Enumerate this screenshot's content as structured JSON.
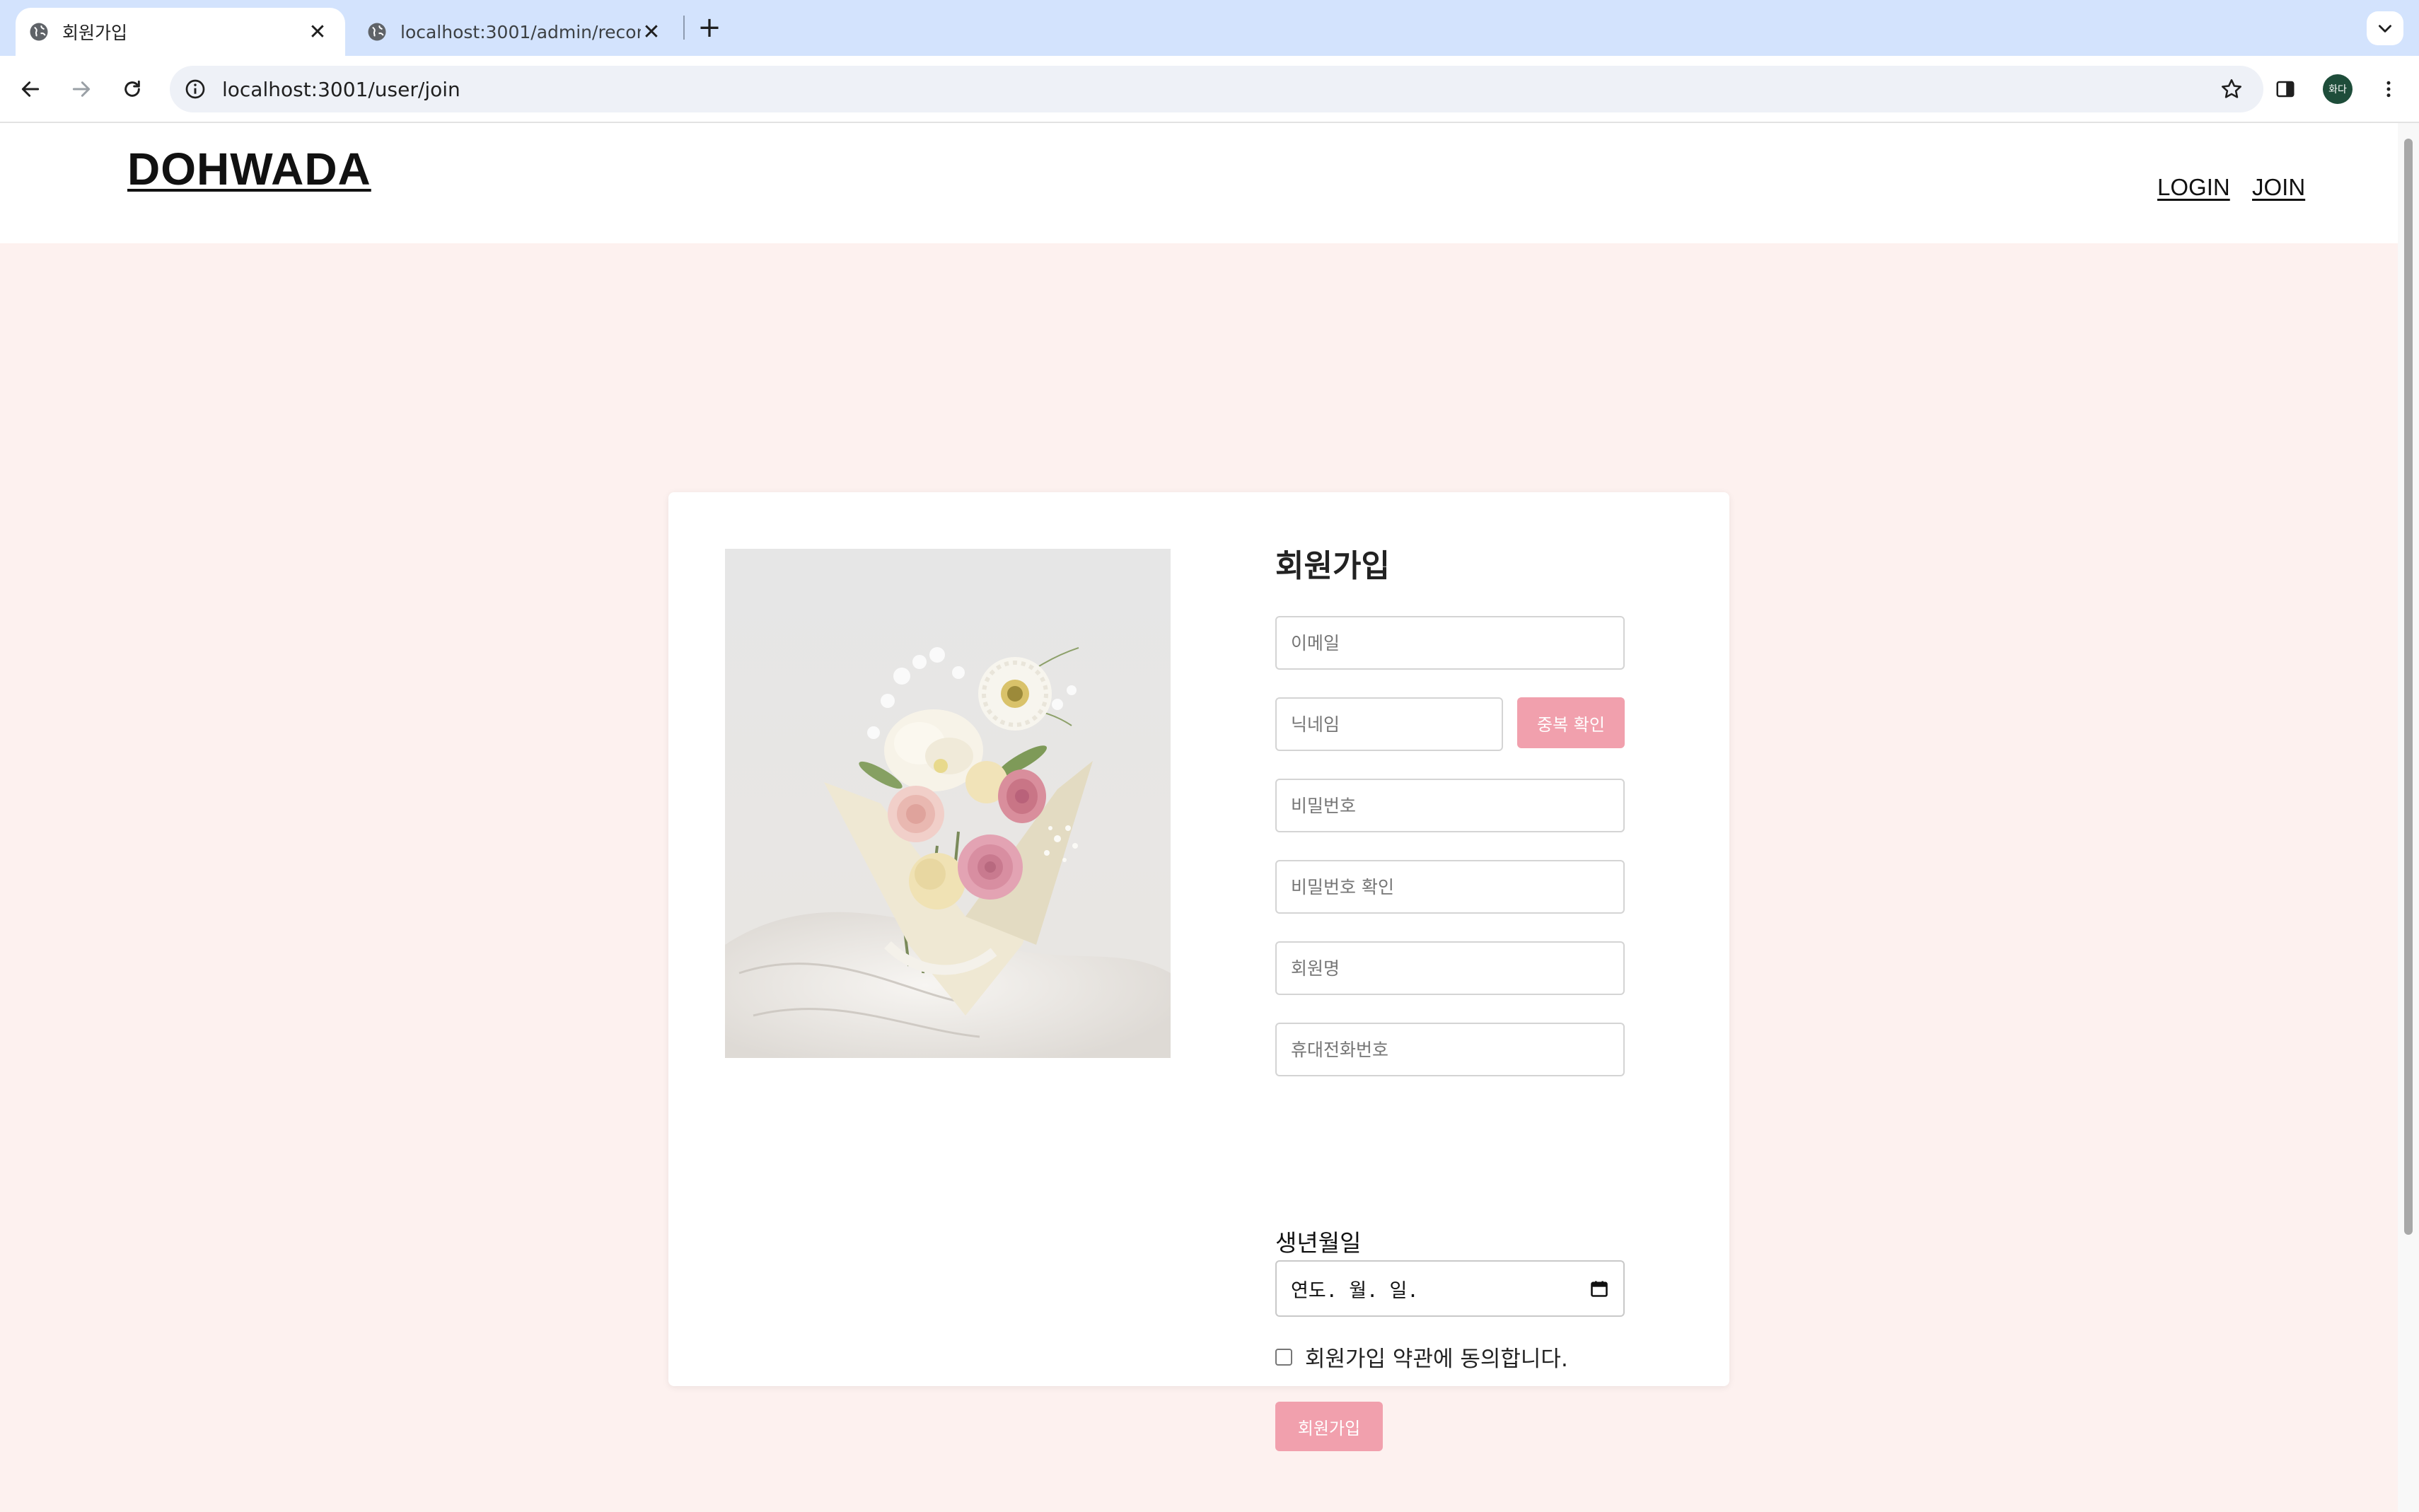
{
  "browser": {
    "tabs": [
      {
        "title": "회원가입",
        "active": true
      },
      {
        "title": "localhost:3001/admin/recom",
        "active": false
      }
    ],
    "new_tab_icon": "plus-icon",
    "url": "localhost:3001/user/join",
    "profile_initials": "화다"
  },
  "site": {
    "logo": "DOHWADA",
    "nav": {
      "login": "LOGIN",
      "join": "JOIN"
    }
  },
  "photo": {
    "alt": "flower bouquet photo",
    "subject": "bouquet with white daisy, white peony, pink roses and cream carnations wrapped in cream paper"
  },
  "form": {
    "title": "회원가입",
    "email_placeholder": "이메일",
    "nickname_placeholder": "닉네임",
    "duplicate_check_label": "중복 확인",
    "password_placeholder": "비밀번호",
    "password_confirm_placeholder": "비밀번호 확인",
    "name_placeholder": "회원명",
    "phone_placeholder": "휴대전화번호",
    "dob_label": "생년월일",
    "dob_value": "연도. 월. 일.",
    "terms_label": "회원가입 약관에 동의합니다.",
    "terms_checked": false,
    "submit_label": "회원가입"
  },
  "colors": {
    "page_background": "#fdf1ef",
    "accent_button": "#f1a0ad",
    "tabstrip": "#d3e3fd"
  }
}
